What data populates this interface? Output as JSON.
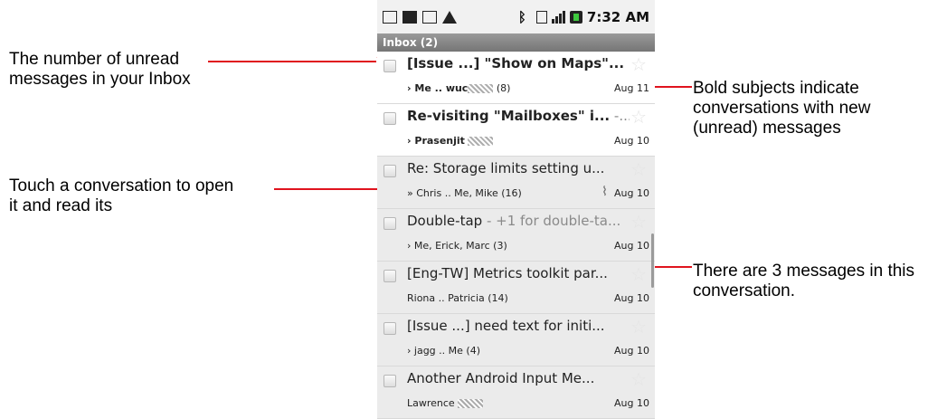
{
  "callouts": {
    "unread": "The number of unread messages in your Inbox",
    "bold": "Bold subjects indicate conversations with new (unread) messages",
    "touch": "Touch a conversation to open it and read its",
    "count": "There are 3 messages in this conversation."
  },
  "statusbar": {
    "time": "7:32 AM"
  },
  "inbox": {
    "label": "Inbox (2)"
  },
  "conversations": [
    {
      "subject": "[Issue ...] \"Show on Maps\"...",
      "snippet": "",
      "senders": "Me .. wuc",
      "count": "(8)",
      "date": "Aug 11",
      "unread": true,
      "arrow": "›"
    },
    {
      "subject": "Re-visiting \"Mailboxes\" i...",
      "snippet": " -...",
      "senders": "Prasenjit",
      "count": "",
      "date": "Aug 10",
      "unread": true,
      "arrow": "›"
    },
    {
      "subject": "Re: Storage limits setting u...",
      "snippet": "",
      "senders": "Chris .. Me, Mike (16)",
      "count": "",
      "date": "Aug 10",
      "unread": false,
      "arrow": "»"
    },
    {
      "subject": "Double-tap",
      "snippet": " - +1 for double-ta...",
      "senders": "Me, Erick, Marc (3)",
      "count": "",
      "date": "Aug 10",
      "unread": false,
      "arrow": "›"
    },
    {
      "subject": "[Eng-TW] Metrics toolkit par...",
      "snippet": "",
      "senders": "Riona .. Patricia (14)",
      "count": "",
      "date": "Aug 10",
      "unread": false,
      "arrow": ""
    },
    {
      "subject": "[Issue ...] need text for initi...",
      "snippet": "",
      "senders": "jagg .. Me (4)",
      "count": "",
      "date": "Aug 10",
      "unread": false,
      "arrow": "›"
    },
    {
      "subject": "Another Android Input Me...",
      "snippet": "",
      "senders": "Lawrence",
      "count": "",
      "date": "Aug 10",
      "unread": false,
      "arrow": ""
    }
  ],
  "icons": {
    "star": "star-icon",
    "checkbox": "checkbox-icon",
    "attachment": "paperclip-icon"
  },
  "colors": {
    "callout_line": "#e0141e",
    "inbox_bar": "#8a8a8a"
  }
}
